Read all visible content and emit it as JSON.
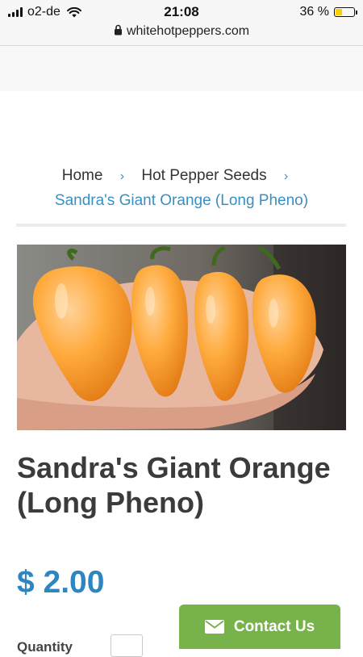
{
  "status_bar": {
    "carrier": "o2-de",
    "time": "21:08",
    "battery": "36 %",
    "battery_level": 0.36,
    "url": "whitehotpeppers.com"
  },
  "breadcrumb": {
    "home": "Home",
    "separator": "›",
    "category": "Hot Pepper Seeds",
    "current": "Sandra's Giant Orange (Long Pheno)"
  },
  "product": {
    "title": "Sandra's Giant Orange (Long Pheno)",
    "price": "$ 2.00",
    "quantity_label": "Quantity"
  },
  "contact": {
    "label": "Contact Us"
  }
}
